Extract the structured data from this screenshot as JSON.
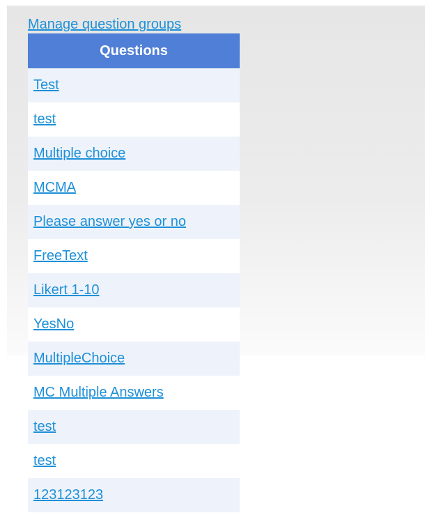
{
  "manage_link": "Manage question groups",
  "table": {
    "header": "Questions",
    "rows": [
      {
        "label": "Test"
      },
      {
        "label": "test"
      },
      {
        "label": "Multiple choice"
      },
      {
        "label": "MCMA"
      },
      {
        "label": "Please answer yes or no"
      },
      {
        "label": "FreeText"
      },
      {
        "label": "Likert 1-10"
      },
      {
        "label": "YesNo"
      },
      {
        "label": "MultipleChoice"
      },
      {
        "label": "MC Multiple Answers"
      },
      {
        "label": "test"
      },
      {
        "label": "test"
      },
      {
        "label": "123123123"
      }
    ]
  },
  "colors": {
    "header_bg": "#4f7fd6",
    "link": "#1e90d8",
    "row_alt_bg": "#eef3fb"
  }
}
